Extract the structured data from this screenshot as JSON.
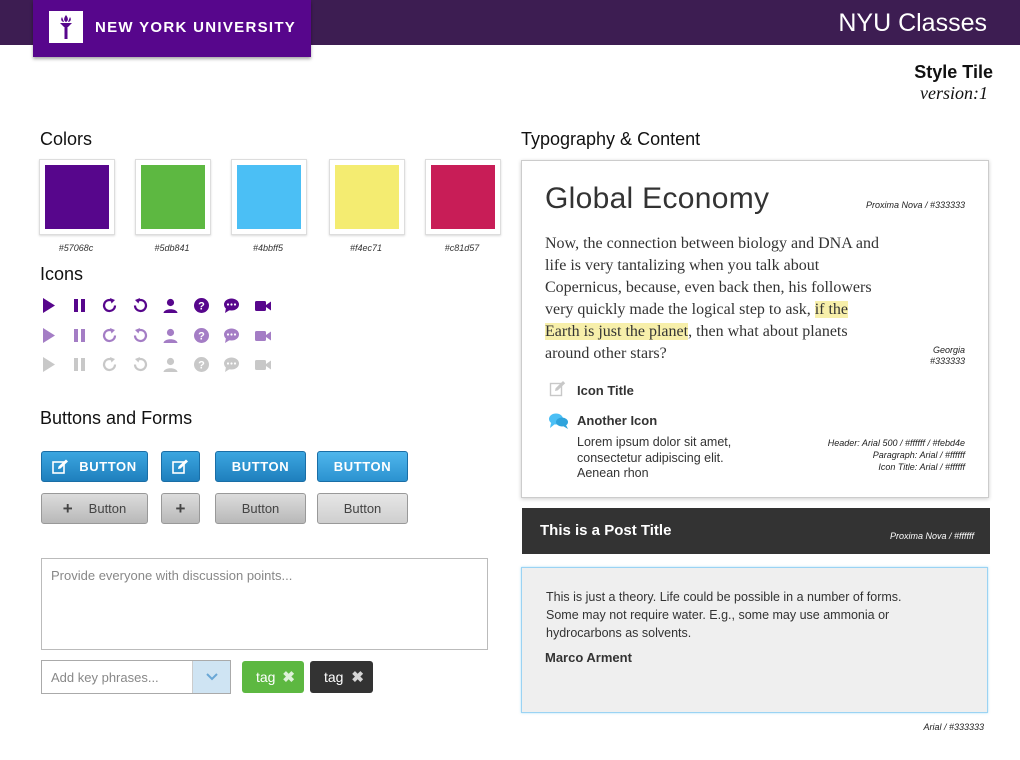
{
  "header": {
    "logo_text": "NEW YORK UNIVERSITY",
    "app_title": "NYU Classes",
    "style_title": "Style Tile",
    "version": "version:1"
  },
  "colors": {
    "heading": "Colors",
    "swatches": [
      {
        "hex": "#57068c",
        "label": "#57068c"
      },
      {
        "hex": "#5db841",
        "label": "#5db841"
      },
      {
        "hex": "#4bbff5",
        "label": "#4bbff5"
      },
      {
        "hex": "#f4ec71",
        "label": "#f4ec71"
      },
      {
        "hex": "#c81d57",
        "label": "#c81d57"
      }
    ]
  },
  "icons": {
    "heading": "Icons",
    "names": [
      "play-icon",
      "pause-icon",
      "refresh-icon",
      "undo-icon",
      "user-icon",
      "help-icon",
      "chat-icon",
      "video-icon"
    ],
    "row_colors": [
      "#57068c",
      "#a47dc5",
      "#c8c8c8"
    ]
  },
  "buttons": {
    "heading": "Buttons and Forms",
    "blue_label": "BUTTON",
    "grey_label": "Button",
    "blue_color": "#2a8fd2",
    "grey_color": "#c5c5c5"
  },
  "forms": {
    "textarea_placeholder": "Provide everyone with discussion points...",
    "select_placeholder": "Add key phrases...",
    "tags": [
      {
        "label": "tag",
        "color": "#5db841"
      },
      {
        "label": "tag",
        "color": "#333333"
      }
    ]
  },
  "typography": {
    "heading": "Typography & Content",
    "title": "Global Economy",
    "title_note": "Proxima Nova / #333333",
    "para_before": "Now, the connection between biology and DNA and life is very tantalizing when you talk about Copernicus, because, even back then, his followers very quickly made the logical step to ask, ",
    "para_highlight": "if the Earth is just the planet",
    "para_after": ", then what about planets around other stars?",
    "para_note_1": "Georgia",
    "para_note_2": "#333333",
    "icon_title": "Icon Title",
    "another_icon": "Another Icon",
    "another_desc": "Lorem ipsum dolor sit amet, consectetur adipiscing elit. Aenean rhon",
    "spec_1": "Header: Arial 500 / #ffffff / #febd4e",
    "spec_2": "Paragraph: Arial / #ffffff",
    "spec_3": "Icon Title: Arial / #ffffff"
  },
  "post": {
    "title": "This is  a Post Title",
    "note": "Proxima Nova / #ffffff"
  },
  "quote": {
    "text": "This is just a theory. Life could be possible in a number of forms. Some may not require water. E.g., some may use ammonia or hydrocarbons as solvents.",
    "author": "Marco Arment",
    "note": "Arial / #333333"
  }
}
